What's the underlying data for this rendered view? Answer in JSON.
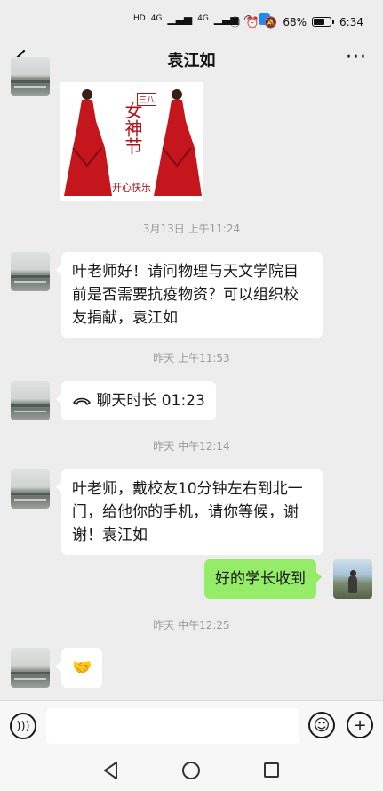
{
  "status_bar": {
    "sim1_label": "HD",
    "sim2_label": "HD",
    "network1": "4G",
    "network2": "4G",
    "battery_percent": "68%",
    "battery_level": 0.68,
    "time": "6:34",
    "icons": [
      "nfc-icon",
      "alarm-icon",
      "mute-icon",
      "wifi-icon",
      "signal-icon",
      "battery-icon"
    ]
  },
  "header": {
    "title": "袁江如",
    "more_label": "···"
  },
  "picture_message": {
    "caption_main": "女神节",
    "caption_side": "三八",
    "caption_bottom": "开心快乐",
    "dress_color": "#c4161c"
  },
  "messages": [
    {
      "time": "3月13日 上午11:24"
    },
    {
      "text": "叶老师好！请问物理与天文学院目前是否需要抗疫物资？可以组织校友捐献，袁江如"
    },
    {
      "time": "昨天 上午11:53"
    },
    {
      "call_text": "聊天时长 01:23"
    },
    {
      "time": "昨天 中午12:14"
    },
    {
      "text": "叶老师，戴校友10分钟左右到北一门，给他你的手机，请你等候，谢谢！袁江如"
    },
    {
      "reply": "好的学长收到"
    },
    {
      "time": "昨天 中午12:25"
    },
    {
      "emoji": "🤝"
    }
  ],
  "colors": {
    "background": "#ededed",
    "incoming_bubble": "#ffffff",
    "outgoing_bubble": "#95ec69",
    "timestamp": "#9b9b9b"
  }
}
